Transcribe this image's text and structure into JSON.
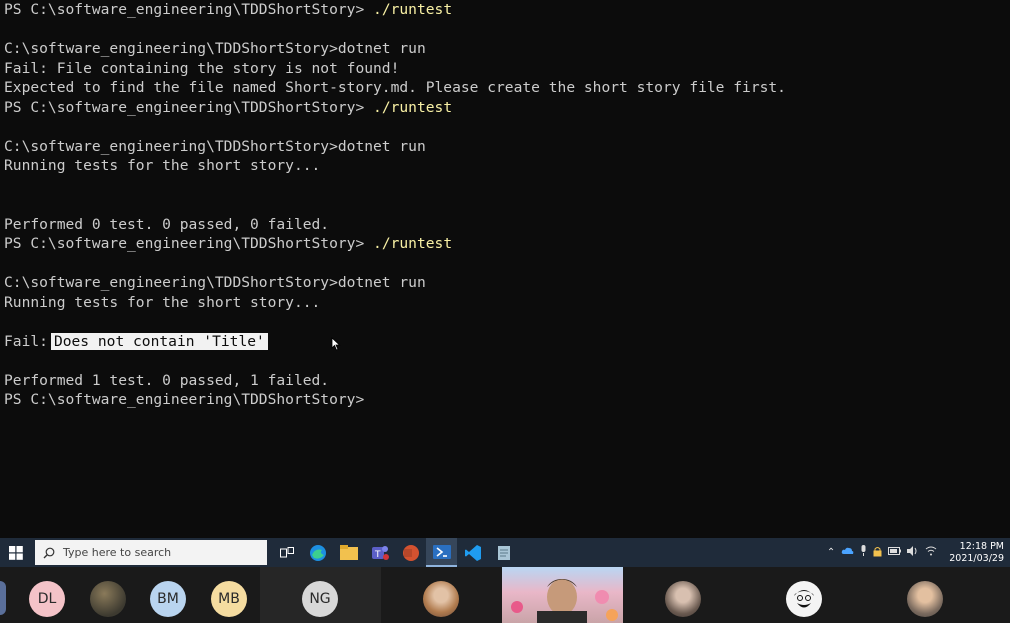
{
  "terminal": {
    "lines": [
      {
        "prompt": "PS C:\\software_engineering\\TDDShortStory> ",
        "command": "./runtest"
      },
      {
        "text": ""
      },
      {
        "text": "C:\\software_engineering\\TDDShortStory>dotnet run"
      },
      {
        "text": "Fail: File containing the story is not found!"
      },
      {
        "text": "Expected to find the file named Short-story.md. Please create the short story file first."
      },
      {
        "prompt": "PS C:\\software_engineering\\TDDShortStory> ",
        "command": "./runtest"
      },
      {
        "text": ""
      },
      {
        "text": "C:\\software_engineering\\TDDShortStory>dotnet run"
      },
      {
        "text": "Running tests for the short story..."
      },
      {
        "text": ""
      },
      {
        "text": ""
      },
      {
        "text": "Performed 0 test. 0 passed, 0 failed."
      },
      {
        "prompt": "PS C:\\software_engineering\\TDDShortStory> ",
        "command": "./runtest"
      },
      {
        "text": ""
      },
      {
        "text": "C:\\software_engineering\\TDDShortStory>dotnet run"
      },
      {
        "text": "Running tests for the short story..."
      },
      {
        "text": ""
      },
      {
        "fail_label": "Fail:",
        "highlight": "Does not contain 'Title'"
      },
      {
        "text": ""
      },
      {
        "text": "Performed 1 test. 0 passed, 1 failed."
      },
      {
        "text": "PS C:\\software_engineering\\TDDShortStory>"
      }
    ]
  },
  "taskbar": {
    "search_placeholder": "Type here to search",
    "clock_time": "12:18 PM",
    "clock_date": "2021/03/29",
    "apps": [
      "task-view",
      "edge",
      "file-explorer",
      "teams",
      "powerpoint",
      "powershell",
      "vscode",
      "notepad"
    ]
  },
  "participants": [
    {
      "initials": "DL",
      "color": "#f4c3c8"
    },
    {
      "initials": "BM",
      "color": "#b9d4ef"
    },
    {
      "initials": "MB",
      "color": "#f5dca0"
    },
    {
      "initials": "NG",
      "color": "#d8d8d8"
    }
  ],
  "colors": {
    "terminal_bg": "#0c0c0c",
    "terminal_text": "#cccccc",
    "command_yellow": "#f9f1a5",
    "taskbar_bg": "#1f2b3a"
  }
}
